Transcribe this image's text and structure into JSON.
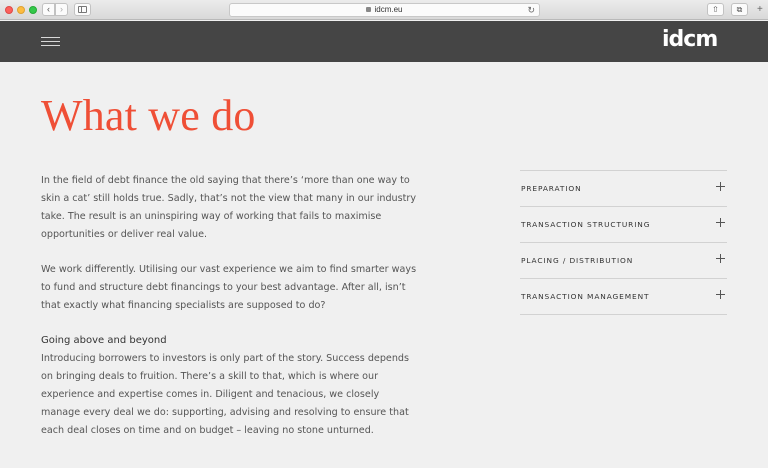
{
  "browser": {
    "url": "idcm.eu",
    "back_glyph": "‹",
    "forward_glyph": "›",
    "reload_glyph": "↻",
    "share_glyph": "⇧",
    "tabs_glyph": "⧉",
    "newtab_glyph": "+"
  },
  "site": {
    "logo": "idcm",
    "menu_icon": "hamburger-icon"
  },
  "page": {
    "title": "What we do",
    "paragraphs": [
      "In the field of debt finance the old saying that there’s ‘more than one way to skin a cat’ still holds true. Sadly, that’s not the view that many in our industry take. The result is an uninspiring way of working that fails to maximise opportunities or deliver real value.",
      "We work differently. Utilising our vast experience we aim to find smarter ways to fund and structure debt financings to your best advantage. After all, isn’t that exactly what financing specialists are supposed to do?"
    ],
    "subheading": "Going above and beyond",
    "subparagraph": "Introducing borrowers to investors is only part of the story. Success depends on bringing deals to fruition. There’s a skill to that, which is where our experience and expertise comes in. Diligent and tenacious, we closely manage every deal we do: supporting, advising and resolving to ensure that each deal closes on time and on budget – leaving no stone unturned."
  },
  "accordion": {
    "items": [
      {
        "label": "PREPARATION"
      },
      {
        "label": "TRANSACTION STRUCTURING"
      },
      {
        "label": "PLACING / DISTRIBUTION"
      },
      {
        "label": "TRANSACTION MANAGEMENT"
      }
    ]
  },
  "colors": {
    "accent": "#ef4f36",
    "header_bg": "#454545",
    "page_bg": "#f0f0f0"
  }
}
